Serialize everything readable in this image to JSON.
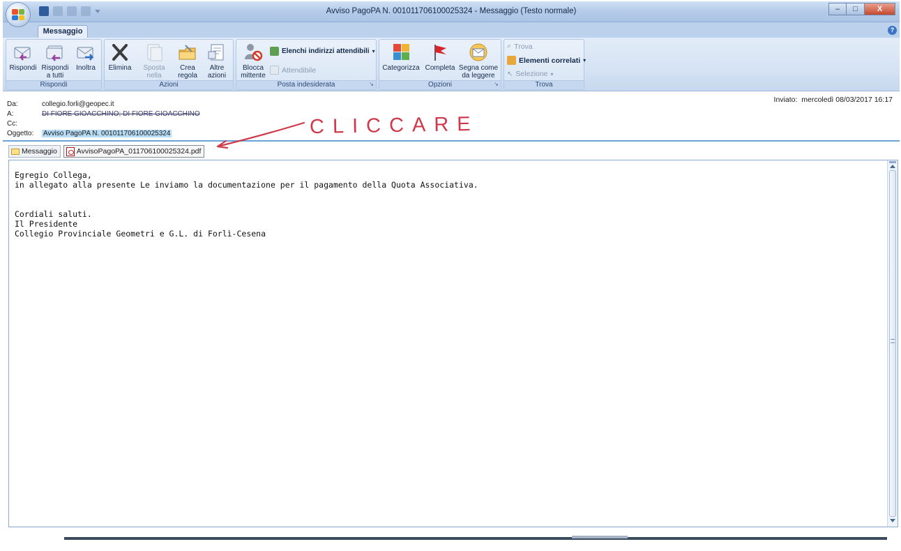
{
  "window": {
    "title": "Avviso PagoPA N. 001011706100025324 - Messaggio (Testo normale)",
    "controls": {
      "minimize": "–",
      "maximize": "□",
      "close": "X"
    }
  },
  "ribbon": {
    "active_tab": "Messaggio",
    "help": "?",
    "groups": {
      "rispondi": {
        "label": "Rispondi",
        "buttons": [
          {
            "label": "Rispondi",
            "icon": "reply-icon"
          },
          {
            "label": "Rispondi a tutti",
            "icon": "reply-all-icon"
          },
          {
            "label": "Inoltra",
            "icon": "forward-icon"
          }
        ]
      },
      "azioni": {
        "label": "Azioni",
        "buttons": [
          {
            "label": "Elimina",
            "icon": "delete-x-icon"
          },
          {
            "label": "Sposta nella cartella",
            "icon": "move-folder-icon"
          },
          {
            "label": "Crea regola",
            "icon": "create-rule-icon"
          },
          {
            "label": "Altre azioni",
            "icon": "other-actions-icon"
          }
        ]
      },
      "posta_indesiderata": {
        "label": "Posta indesiderata",
        "blocca": "Blocca mittente",
        "elenchi": "Elenchi indirizzi attendibili",
        "attendibile": "Attendibile"
      },
      "opzioni": {
        "label": "Opzioni",
        "buttons": [
          {
            "label": "Categorizza",
            "icon": "categorize-icon"
          },
          {
            "label": "Completa",
            "icon": "flag-icon"
          },
          {
            "label": "Segna come da leggere",
            "icon": "mark-unread-icon"
          }
        ]
      },
      "trova": {
        "label": "Trova",
        "trova": "Trova",
        "elementi": "Elementi correlati",
        "selezione": "Selezione"
      }
    }
  },
  "message": {
    "from_label": "Da:",
    "from": "collegio.forli@geopec.it",
    "to_label": "A:",
    "to": "DI FIORE GIOACCHINO; DI FIORE GIOACCHINO",
    "cc_label": "Cc:",
    "cc": "",
    "subject_label": "Oggetto:",
    "subject": "Avviso PagoPA N. 001011706100025324",
    "sent_label": "Inviato:",
    "sent": "mercoledì 08/03/2017 16:17"
  },
  "attachments": {
    "message_tab": "Messaggio",
    "file": "AvvisoPagoPA_011706100025324.pdf"
  },
  "body": {
    "text": "Egregio Collega,\nin allegato alla presente Le inviamo la documentazione per il pagamento della Quota Associativa.\n\n\nCordiali saluti.\nIl Presidente\nCollegio Provinciale Geometri e G.L. di Forlì-Cesena"
  },
  "annotation": {
    "text": "CLICCARE",
    "color": "#cf3a4a"
  },
  "colors": {
    "accent": "#3c74c5",
    "ribbon": "#d5e3f4",
    "subject_highlight": "#b7dcf6"
  }
}
